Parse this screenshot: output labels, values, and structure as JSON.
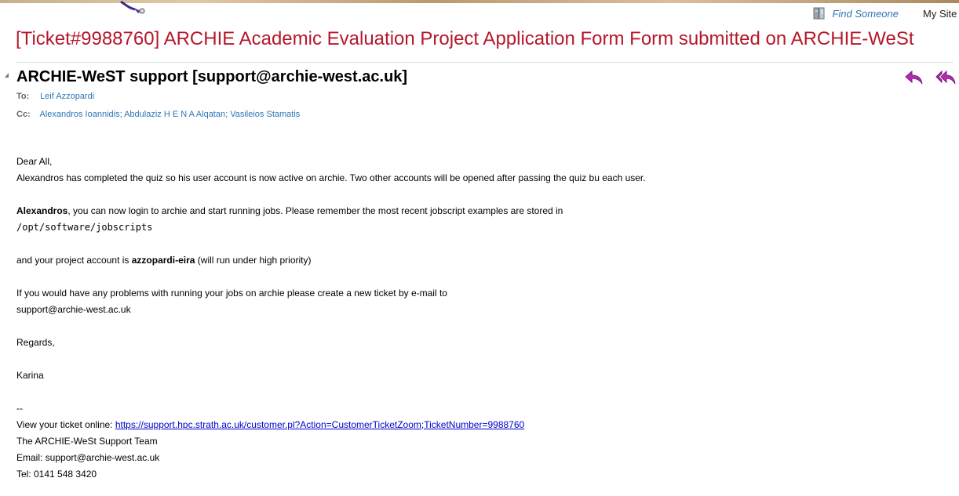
{
  "topbar": {
    "find_someone": "Find Someone",
    "my_site": "My Site"
  },
  "email": {
    "subject": "[Ticket#9988760] ARCHIE Academic Evaluation Project Application Form Form submitted on ARCHIE-WeSt",
    "sender": "ARCHIE-WeST support [support@archie-west.ac.uk]",
    "to_label": "To:",
    "to": "Leif Azzopardi",
    "cc_label": "Cc:",
    "cc": "Alexandros Ioannidis; Abdulaziz H E N A Alqatan; Vasileios Stamatis"
  },
  "body": {
    "greeting": "Dear All,",
    "line1": "Alexandros has completed the quiz so his user account is now active on archie. Two other accounts will be opened after passing the quiz bu each user.",
    "line2_bold": "Alexandros",
    "line2_rest": ", you can now login to archie and start running jobs. Please remember the most recent jobscript examples are stored in",
    "path": "/opt/software/jobscripts",
    "line3_pre": "and your project account is ",
    "line3_bold": "azzopardi-eira",
    "line3_post": " (will run under high priority)",
    "line4": "If you would have any problems with running your jobs on archie please create a new ticket by e-mail to",
    "line5": "support@archie-west.ac.uk",
    "regards": "Regards,",
    "name": "Karina",
    "sig_sep": "--",
    "view_label": "View your ticket online: ",
    "ticket_url": "https://support.hpc.strath.ac.uk/customer.pl?Action=CustomerTicketZoom;TicketNumber=9988760",
    "team": "The ARCHIE-WeSt Support Team",
    "email_line": "Email: support@archie-west.ac.uk",
    "tel_line": "Tel: 0141 548 3420"
  },
  "colors": {
    "subject": "#b5182b",
    "link": "#2e74b5",
    "reply_icon": "#b22db5"
  }
}
